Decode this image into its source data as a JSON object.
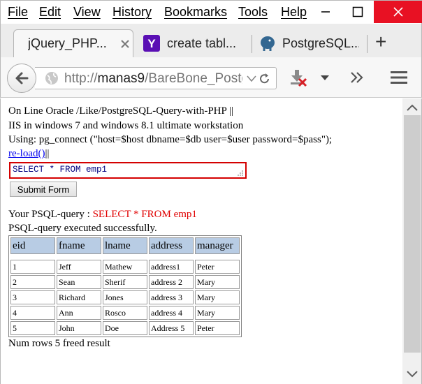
{
  "menu": {
    "items": [
      "File",
      "Edit",
      "View",
      "History",
      "Bookmarks",
      "Tools",
      "Help"
    ]
  },
  "tabs": [
    {
      "label": "jQuery_PHP...",
      "icon": "none",
      "active": true
    },
    {
      "label": "create tabl...",
      "icon": "yahoo-icon"
    },
    {
      "label": "PostgreSQL...",
      "icon": "postgresql-elephant-icon"
    }
  ],
  "nav": {
    "url_prefix": "http://",
    "url_host": "manas9",
    "url_path": "/BareBone_Postg"
  },
  "page": {
    "line1": "On Line Oracle /Like/PostgreSQL-Query-with-PHP ||",
    "line2": "IIS in windows 7 and windows 8.1 ultimate workstation",
    "line3": "Using: pg_connect (\"host=$host dbname=$db user=$user password=$pass\");",
    "reload_link": "re-load()",
    "reload_suffix": "||",
    "query_value": "SELECT * FROM emp1",
    "submit_label": "Submit Form",
    "psql_label": "Your PSQL-query : ",
    "psql_query": "SELECT * FROM emp1",
    "success_text": "PSQL-query executed successfully.",
    "footer_text": "Num rows 5 freed result"
  },
  "table": {
    "headers": [
      "eid",
      "fname",
      "lname",
      "address",
      "manager"
    ],
    "rows": [
      [
        "1",
        "Jeff",
        "Mathew",
        "address1",
        "Peter"
      ],
      [
        "2",
        "Sean",
        "Sherif",
        "address 2",
        "Mary"
      ],
      [
        "3",
        "Richard",
        "Jones",
        "address 3",
        "Mary"
      ],
      [
        "4",
        "Ann",
        "Rosco",
        "address 4",
        "Mary"
      ],
      [
        "5",
        "John",
        "Doe",
        "Address 5",
        "Peter"
      ]
    ]
  },
  "colors": {
    "header_fill": "#b8cce4",
    "query_border": "#d40000",
    "link": "#0000ee",
    "query_text": "#e00000"
  }
}
